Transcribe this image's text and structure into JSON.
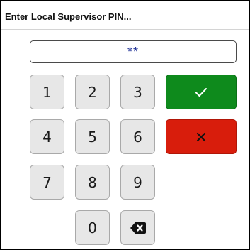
{
  "dialog": {
    "title": "Enter Local Supervisor PIN..."
  },
  "pin": {
    "masked_value": "**"
  },
  "keypad": {
    "keys": [
      "1",
      "2",
      "3",
      "4",
      "5",
      "6",
      "7",
      "8",
      "9",
      "0"
    ],
    "backspace_icon": "backspace-icon",
    "confirm_icon": "checkmark-icon",
    "cancel_icon": "close-icon"
  },
  "colors": {
    "confirm": "#0e8a1c",
    "cancel": "#d81d0c",
    "pin_text": "#27389a",
    "key_bg": "#e7e7e7"
  }
}
